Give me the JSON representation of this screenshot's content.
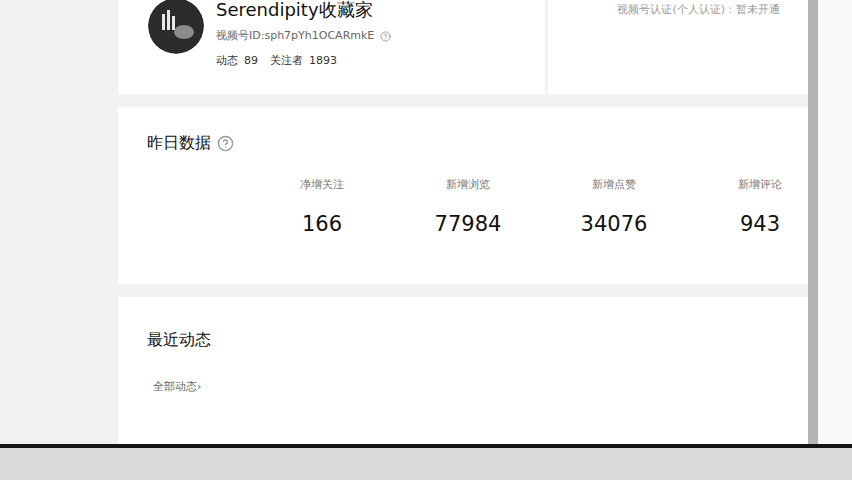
{
  "profile": {
    "name": "Serendipity收藏家",
    "id": "视频号ID:sph7pYh1OCARmkE",
    "stats": [
      {
        "label": "动态",
        "value": "89"
      },
      {
        "label": "关注者",
        "value": "1893"
      }
    ]
  },
  "side_card": {
    "text": "视频号认证(个人认证)：暂未开通"
  },
  "yesterday": {
    "title": "昨日数据",
    "metrics": [
      {
        "label": "净增关注",
        "value": "166"
      },
      {
        "label": "新增浏览",
        "value": "77984"
      },
      {
        "label": "新增点赞",
        "value": "34076"
      },
      {
        "label": "新增评论",
        "value": "943"
      }
    ]
  },
  "recent": {
    "title": "最近动态",
    "link": "全部动态›"
  }
}
